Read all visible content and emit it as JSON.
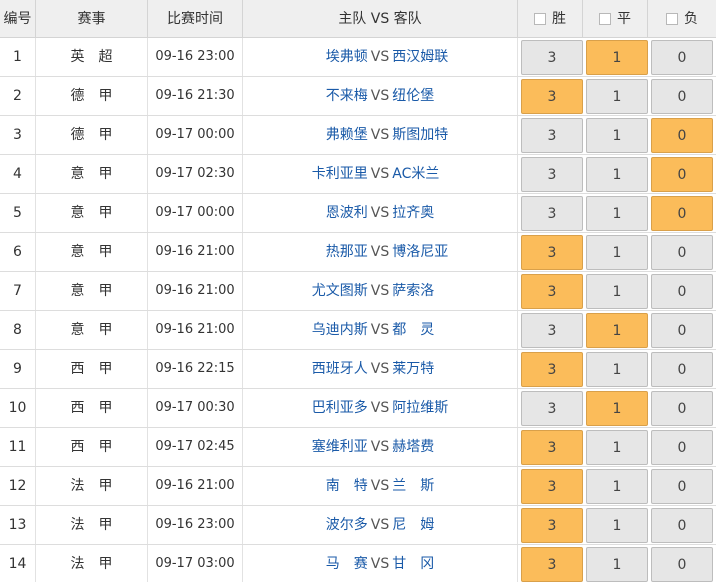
{
  "header": {
    "no": "编号",
    "league": "赛事",
    "time": "比赛时间",
    "match": "主队 VS 客队",
    "win": "胜",
    "draw": "平",
    "lose": "负"
  },
  "vs_label": "VS",
  "colors": {
    "selected": "#fbbc5a",
    "button": "#e6e6e6",
    "team_link": "#1a5aa8"
  },
  "rows": [
    {
      "no": "1",
      "league": "英超",
      "time": "09-16 23:00",
      "home": "埃弗顿",
      "away": "西汉姆联",
      "w": "3",
      "d": "1",
      "l": "0",
      "sel": "d"
    },
    {
      "no": "2",
      "league": "德甲",
      "time": "09-16 21:30",
      "home": "不来梅",
      "away": "纽伦堡",
      "w": "3",
      "d": "1",
      "l": "0",
      "sel": "w"
    },
    {
      "no": "3",
      "league": "德甲",
      "time": "09-17 00:00",
      "home": "弗赖堡",
      "away": "斯图加特",
      "w": "3",
      "d": "1",
      "l": "0",
      "sel": "l"
    },
    {
      "no": "4",
      "league": "意甲",
      "time": "09-17 02:30",
      "home": "卡利亚里",
      "away": "AC米兰",
      "w": "3",
      "d": "1",
      "l": "0",
      "sel": "l"
    },
    {
      "no": "5",
      "league": "意甲",
      "time": "09-17 00:00",
      "home": "恩波利",
      "away": "拉齐奥",
      "w": "3",
      "d": "1",
      "l": "0",
      "sel": "l"
    },
    {
      "no": "6",
      "league": "意甲",
      "time": "09-16 21:00",
      "home": "热那亚",
      "away": "博洛尼亚",
      "w": "3",
      "d": "1",
      "l": "0",
      "sel": "w"
    },
    {
      "no": "7",
      "league": "意甲",
      "time": "09-16 21:00",
      "home": "尤文图斯",
      "away": "萨索洛",
      "w": "3",
      "d": "1",
      "l": "0",
      "sel": "w"
    },
    {
      "no": "8",
      "league": "意甲",
      "time": "09-16 21:00",
      "home": "乌迪内斯",
      "away": "都　灵",
      "w": "3",
      "d": "1",
      "l": "0",
      "sel": "d"
    },
    {
      "no": "9",
      "league": "西甲",
      "time": "09-16 22:15",
      "home": "西班牙人",
      "away": "莱万特",
      "w": "3",
      "d": "1",
      "l": "0",
      "sel": "w"
    },
    {
      "no": "10",
      "league": "西甲",
      "time": "09-17 00:30",
      "home": "巴利亚多",
      "away": "阿拉维斯",
      "w": "3",
      "d": "1",
      "l": "0",
      "sel": "d"
    },
    {
      "no": "11",
      "league": "西甲",
      "time": "09-17 02:45",
      "home": "塞维利亚",
      "away": "赫塔费",
      "w": "3",
      "d": "1",
      "l": "0",
      "sel": "w"
    },
    {
      "no": "12",
      "league": "法甲",
      "time": "09-16 21:00",
      "home": "南　特",
      "away": "兰　斯",
      "w": "3",
      "d": "1",
      "l": "0",
      "sel": "w"
    },
    {
      "no": "13",
      "league": "法甲",
      "time": "09-16 23:00",
      "home": "波尔多",
      "away": "尼　姆",
      "w": "3",
      "d": "1",
      "l": "0",
      "sel": "w"
    },
    {
      "no": "14",
      "league": "法甲",
      "time": "09-17 03:00",
      "home": "马　赛",
      "away": "甘　冈",
      "w": "3",
      "d": "1",
      "l": "0",
      "sel": "w"
    }
  ]
}
